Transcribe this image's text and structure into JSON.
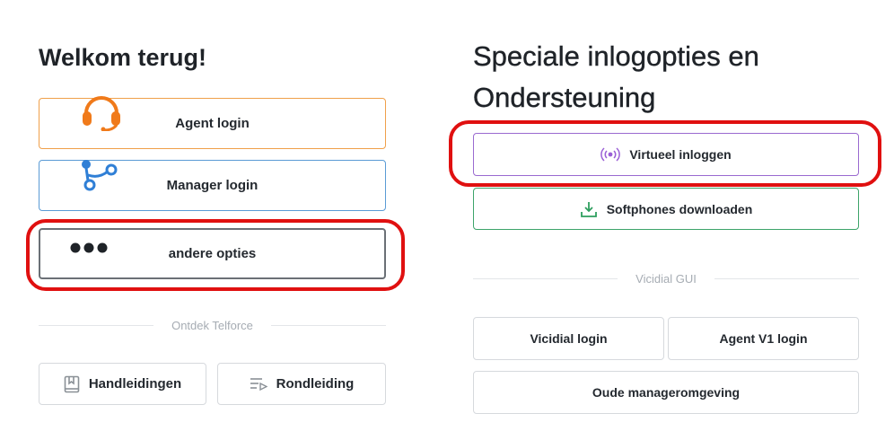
{
  "left": {
    "title": "Welkom terug!",
    "agent_login": {
      "label": "Agent login",
      "icon": "headset-icon",
      "color": "#f07a1a"
    },
    "manager_login": {
      "label": "Manager login",
      "icon": "branch-icon",
      "color": "#2f7fd6"
    },
    "other_options": {
      "label": "andere opties",
      "icon": "dots-icon"
    },
    "divider_label": "Ontdek Telforce",
    "manuals": {
      "label": "Handleidingen",
      "icon": "book-icon"
    },
    "tour": {
      "label": "Rondleiding",
      "icon": "list-play-icon"
    }
  },
  "right": {
    "title": "Speciale inlogopties en Ondersteuning",
    "virtual_login": {
      "label": "Virtueel inloggen",
      "icon": "broadcast-icon",
      "color": "#9a5fd6"
    },
    "softphones": {
      "label": "Softphones downloaden",
      "icon": "download-icon",
      "color": "#2e9e5e"
    },
    "divider_label": "Vicidial GUI",
    "vicidial_login": {
      "label": "Vicidial login"
    },
    "agent_v1_login": {
      "label": "Agent V1 login"
    },
    "old_manager": {
      "label": "Oude manageromgeving"
    }
  },
  "highlight_color": "#e01010"
}
